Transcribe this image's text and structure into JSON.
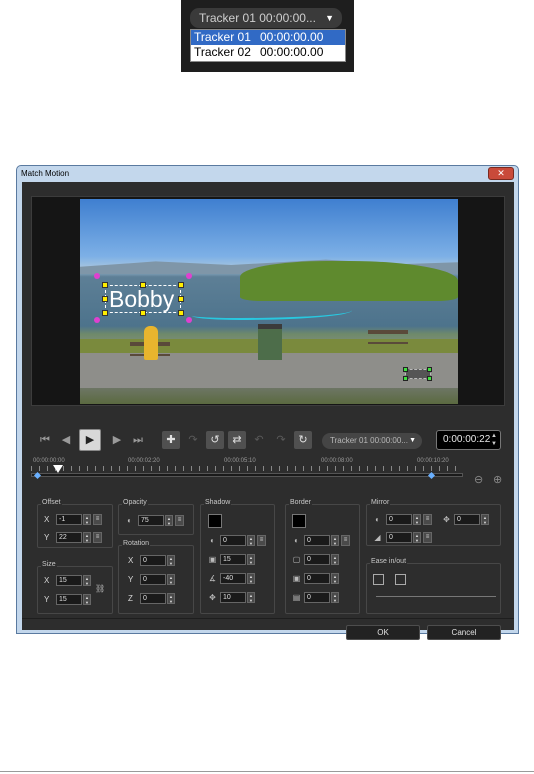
{
  "dropdown_callout": {
    "combo_label": "Tracker 01  00:00:00...",
    "options": [
      {
        "name": "Tracker 01",
        "time": "00:00:00.00",
        "selected": true
      },
      {
        "name": "Tracker 02",
        "time": "00:00:00.00",
        "selected": false
      }
    ]
  },
  "window": {
    "title": "Match Motion",
    "close_label": "✕",
    "overlay_text": "Bobby",
    "toolbar": {
      "tracker_combo": "Tracker 01  00:00:00...",
      "timecode": "0:00:00:22"
    },
    "timeline": {
      "tick_labels": [
        "00:00:00:00",
        "00:00:02:20",
        "00:00:05:10",
        "00:00:08:00",
        "00:00:10:20"
      ]
    },
    "offset": {
      "title": "Offset",
      "x_label": "X",
      "x_value": "-1",
      "y_label": "Y",
      "y_value": "22"
    },
    "size": {
      "title": "Size",
      "x_label": "X",
      "x_value": "15",
      "y_label": "Y",
      "y_value": "15"
    },
    "opacity": {
      "title": "Opacity",
      "value": "75"
    },
    "rotation": {
      "title": "Rotation",
      "x_label": "X",
      "x_value": "0",
      "y_label": "Y",
      "y_value": "0",
      "z_label": "Z",
      "z_value": "0"
    },
    "shadow": {
      "title": "Shadow",
      "color": "#000000",
      "opacity": "0",
      "blur": "15",
      "angle": "-40",
      "distance": "10"
    },
    "border": {
      "title": "Border",
      "color": "#000000",
      "opacity": "0",
      "v1": "0",
      "v2": "0",
      "v3": "0"
    },
    "mirror": {
      "title": "Mirror",
      "opacity": "0",
      "offset": "0",
      "fade": "0"
    },
    "ease": {
      "title": "Ease in/out"
    },
    "buttons": {
      "ok": "OK",
      "cancel": "Cancel"
    }
  }
}
